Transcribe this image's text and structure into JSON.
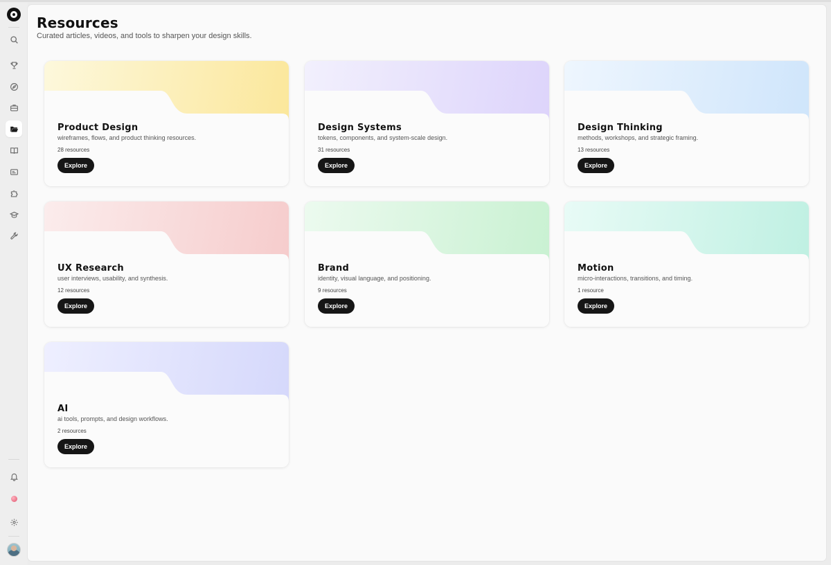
{
  "header": {
    "title": "Resources",
    "subtitle": "Curated articles, videos, and tools to sharpen your design skills."
  },
  "sidebar": {
    "items": [
      {
        "icon": "search-icon",
        "active": false
      },
      {
        "icon": "trophy-icon",
        "active": false
      },
      {
        "icon": "compass-icon",
        "active": false
      },
      {
        "icon": "briefcase-icon",
        "active": false
      },
      {
        "icon": "folder-open-icon",
        "active": true
      },
      {
        "icon": "book-icon",
        "active": false
      },
      {
        "icon": "id-card-icon",
        "active": false
      },
      {
        "icon": "puzzle-icon",
        "active": false
      },
      {
        "icon": "graduation-cap-icon",
        "active": false
      },
      {
        "icon": "wrench-icon",
        "active": false
      }
    ],
    "bottom": [
      {
        "icon": "bell-icon"
      },
      {
        "icon": "status-dot-icon"
      },
      {
        "icon": "gear-icon"
      },
      {
        "icon": "avatar"
      }
    ]
  },
  "cards": [
    {
      "title": "Product Design",
      "description": "wireframes, flows, and product thinking resources.",
      "count": "28 resources",
      "button": "Explore",
      "color_from": "#fdf8dc",
      "color_to": "#fbe79b"
    },
    {
      "title": "Design Systems",
      "description": "tokens, components, and system-scale design.",
      "count": "31 resources",
      "button": "Explore",
      "color_from": "#f2f0fd",
      "color_to": "#ddd4fb"
    },
    {
      "title": "Design Thinking",
      "description": "methods, workshops, and strategic framing.",
      "count": "13 resources",
      "button": "Explore",
      "color_from": "#eef6fe",
      "color_to": "#cfe5fb"
    },
    {
      "title": "UX Research",
      "description": "user interviews, usability, and synthesis.",
      "count": "12 resources",
      "button": "Explore",
      "color_from": "#fbecec",
      "color_to": "#f6cccc"
    },
    {
      "title": "Brand",
      "description": "identity, visual language, and positioning.",
      "count": "9 resources",
      "button": "Explore",
      "color_from": "#ecfaef",
      "color_to": "#c9f1d2"
    },
    {
      "title": "Motion",
      "description": "micro-interactions, transitions, and timing.",
      "count": "1 resource",
      "button": "Explore",
      "color_from": "#e8fbf6",
      "color_to": "#bff0e2"
    },
    {
      "title": "AI",
      "description": "ai tools, prompts, and design workflows.",
      "count": "2 resources",
      "button": "Explore",
      "color_from": "#eeefff",
      "color_to": "#d5d8fb"
    }
  ]
}
